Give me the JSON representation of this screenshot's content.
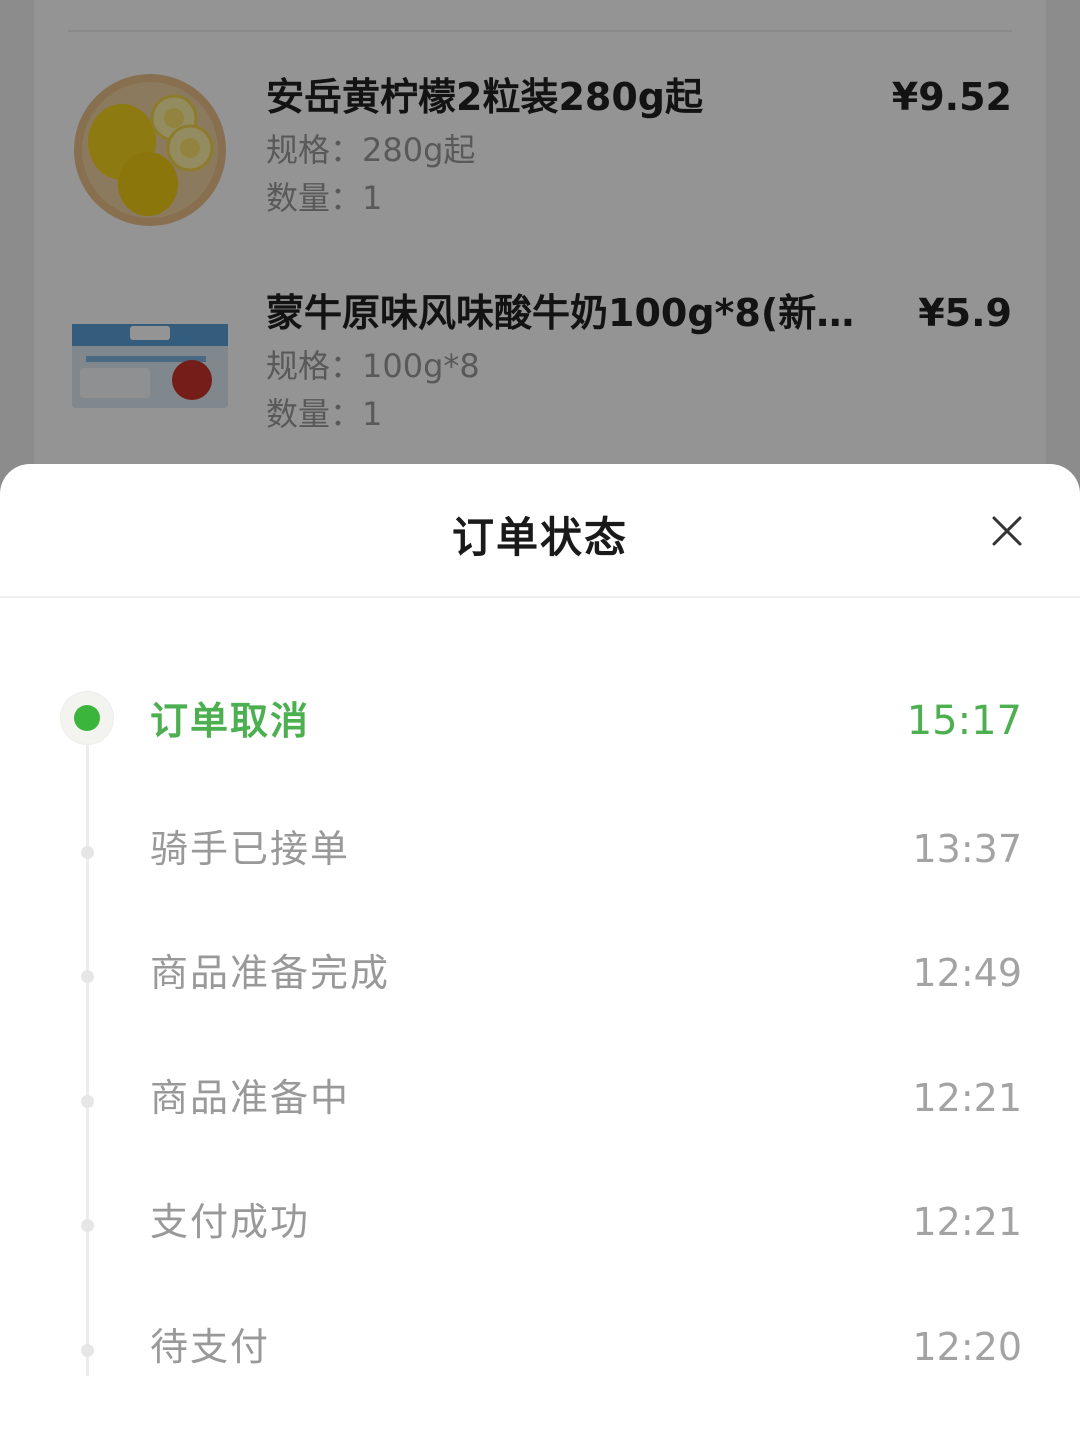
{
  "order_items": [
    {
      "name": "安岳黄柠檬2粒装280g起",
      "price": "¥9.52",
      "spec": "规格：280g起",
      "qty": "数量：1",
      "image": "lemon-image"
    },
    {
      "name": "蒙牛原味风味酸牛奶100g*8(新…",
      "price": "¥5.9",
      "spec": "规格：100g*8",
      "qty": "数量：1",
      "image": "yogurt-pack-image"
    }
  ],
  "sheet": {
    "title": "订单状态",
    "close_icon": "close-icon"
  },
  "timeline": [
    {
      "label": "订单取消",
      "time": "15:17",
      "active": true
    },
    {
      "label": "骑手已接单",
      "time": "13:37",
      "active": false
    },
    {
      "label": "商品准备完成",
      "time": "12:49",
      "active": false
    },
    {
      "label": "商品准备中",
      "time": "12:21",
      "active": false
    },
    {
      "label": "支付成功",
      "time": "12:21",
      "active": false
    },
    {
      "label": "待支付",
      "time": "12:20",
      "active": false
    }
  ],
  "colors": {
    "accent_green": "#3cb53c",
    "muted_text": "#999999",
    "overlay": "rgba(0,0,0,0.42)"
  }
}
